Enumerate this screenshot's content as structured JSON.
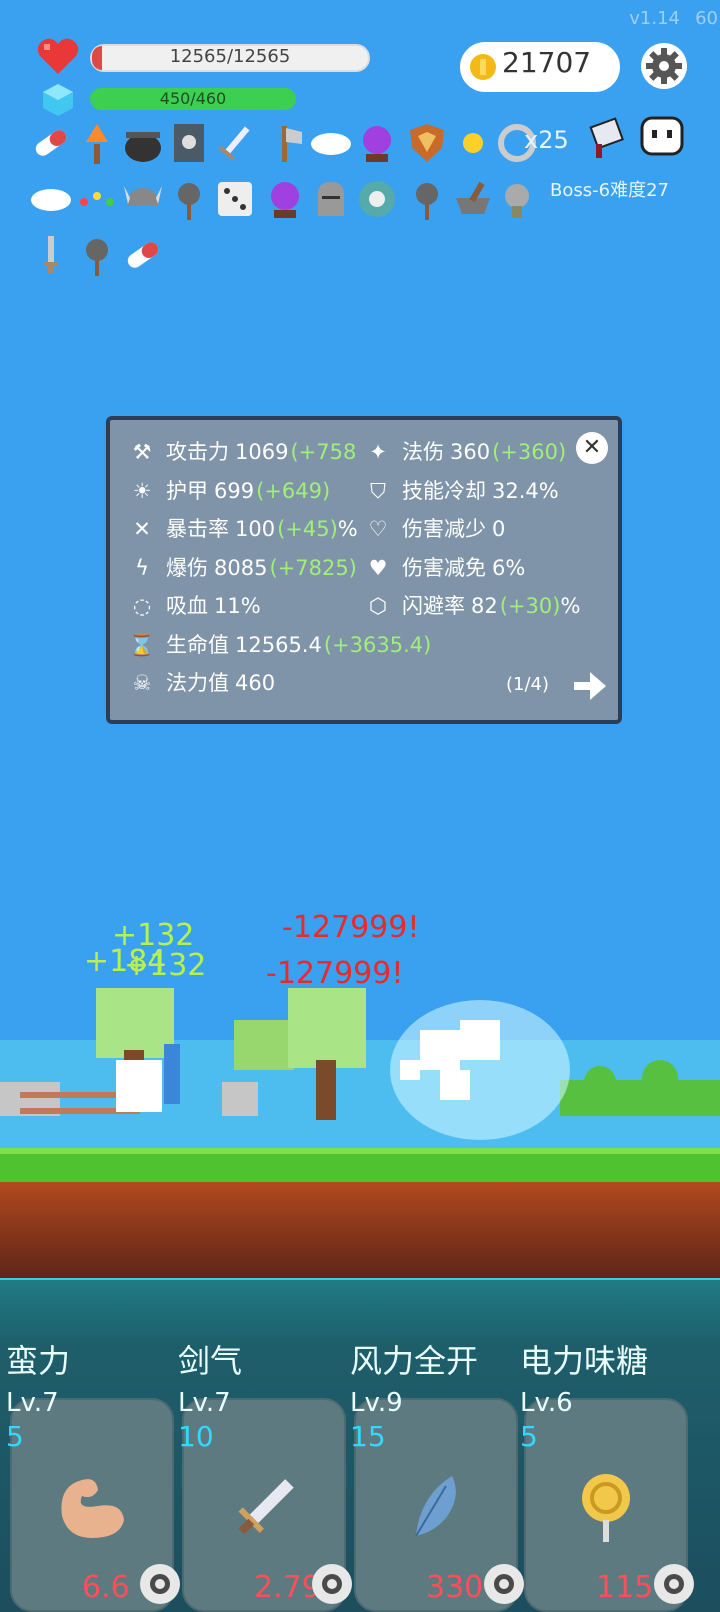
{
  "hud": {
    "version": "v1.14",
    "fps": "60",
    "hp": "12565/12565",
    "mp": "450/460",
    "coins": "21707",
    "stack_count": "x25",
    "boss_info": "Boss-6难度27"
  },
  "items": [
    "pill-icon",
    "torch-icon",
    "cauldron-icon",
    "skull-book-icon",
    "sword-icon",
    "axe-icon",
    "wing-icon",
    "crystal-ball-icon",
    "shield-icon",
    "sun-icon",
    "ring-icon",
    "wing-icon",
    "chain-icon",
    "viking-helmet-icon",
    "mace-icon",
    "dice-icon",
    "crystal-ball-icon",
    "knight-helmet-icon",
    "round-shield-icon",
    "mace-icon",
    "mortar-icon",
    "medal-icon",
    "dagger-icon",
    "mace-icon",
    "pill-icon"
  ],
  "stats": {
    "left": [
      {
        "icon": "axe-icon",
        "label": "攻击力",
        "value": "1069",
        "bonus": "(+758"
      },
      {
        "icon": "sun-icon",
        "label": "护甲",
        "value": "699",
        "bonus": "(+649)"
      },
      {
        "icon": "crossed-swords-icon",
        "label": "暴击率",
        "value": "100",
        "bonus": "(+45)",
        "suffix": "%"
      },
      {
        "icon": "lightning-icon",
        "label": "爆伤",
        "value": "8085",
        "bonus": "(+7825)"
      },
      {
        "icon": "vampire-ring-icon",
        "label": "吸血",
        "value": "11%",
        "bonus": ""
      },
      {
        "icon": "hourglass-icon",
        "label": "生命值",
        "value": "12565.4",
        "bonus": "(+3635.4)"
      },
      {
        "icon": "horned-skull-icon",
        "label": "法力值",
        "value": "460",
        "bonus": ""
      }
    ],
    "right": [
      {
        "icon": "wand-icon",
        "label": "法伤",
        "value": "360",
        "bonus": "(+360)"
      },
      {
        "icon": "shield-outline-icon",
        "label": "技能冷却",
        "value": "32.4%",
        "bonus": ""
      },
      {
        "icon": "heart-shield-icon",
        "label": "伤害减少",
        "value": "0",
        "bonus": ""
      },
      {
        "icon": "heart-icon",
        "label": "伤害减免",
        "value": "6%",
        "bonus": ""
      },
      {
        "icon": "gem-outline-icon",
        "label": "闪避率",
        "value": "82",
        "bonus": "(+30)",
        "suffix": "%"
      }
    ],
    "page": "(1/4)"
  },
  "battle": {
    "damage": [
      "-127999!",
      "-127999!"
    ],
    "heals": [
      "+132",
      "+184",
      "+132"
    ]
  },
  "skills": [
    {
      "name": "蛮力",
      "level": "Lv.7",
      "cost": "5",
      "value": "6.6",
      "icon": "muscle-arm-icon"
    },
    {
      "name": "剑气",
      "level": "Lv.7",
      "cost": "10",
      "value": "2.79 k",
      "icon": "sword-icon"
    },
    {
      "name": "风力全开",
      "level": "Lv.9",
      "cost": "15",
      "value": "330",
      "icon": "feather-icon"
    },
    {
      "name": "电力味糖",
      "level": "Lv.6",
      "cost": "5",
      "value": "115",
      "icon": "lollipop-icon"
    }
  ],
  "colors": {
    "sky": "#3aa1f0",
    "panel": "#7f94a8",
    "bonus": "#9ff07b",
    "damage": "#e82a2a",
    "heal": "#b8f04e",
    "skill_value": "#ff4d5a",
    "cost": "#33d7ff"
  }
}
